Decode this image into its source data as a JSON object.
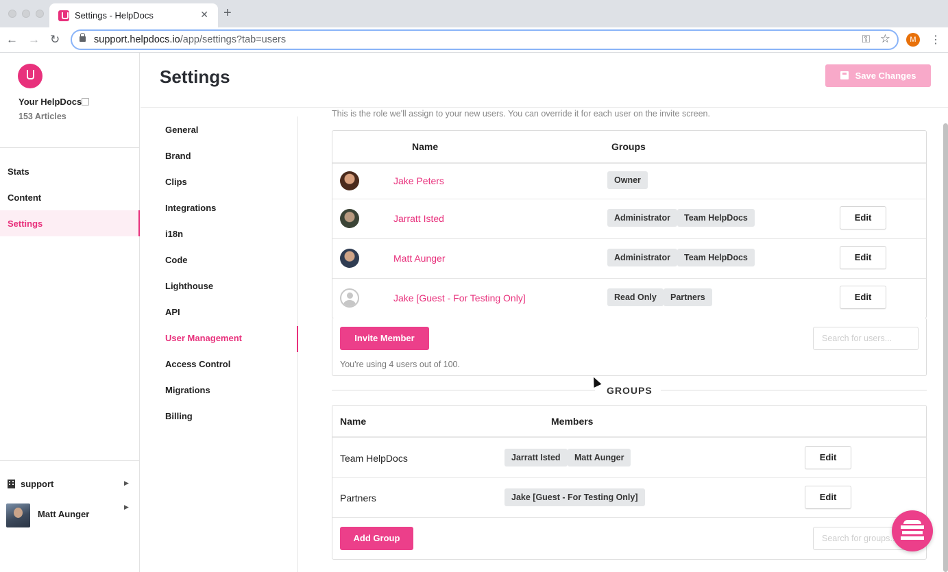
{
  "browser": {
    "tab_title": "Settings - HelpDocs",
    "url_host": "support.helpdocs.io",
    "url_path": "/app/settings?tab=users",
    "profile_initial": "M"
  },
  "sidebar": {
    "site_name": "Your HelpDocs",
    "article_count": "153 Articles",
    "nav": [
      {
        "label": "Stats",
        "active": false
      },
      {
        "label": "Content",
        "active": false
      },
      {
        "label": "Settings",
        "active": true
      }
    ],
    "org": "support",
    "user": "Matt Aunger"
  },
  "header": {
    "title": "Settings",
    "save_label": "Save Changes"
  },
  "settings_nav": [
    {
      "label": "General"
    },
    {
      "label": "Brand"
    },
    {
      "label": "Clips"
    },
    {
      "label": "Integrations"
    },
    {
      "label": "i18n"
    },
    {
      "label": "Code"
    },
    {
      "label": "Lighthouse"
    },
    {
      "label": "API"
    },
    {
      "label": "User Management",
      "active": true
    },
    {
      "label": "Access Control"
    },
    {
      "label": "Migrations"
    },
    {
      "label": "Billing"
    }
  ],
  "users": {
    "hint": "This is the role we'll assign to your new users. You can override it for each user on the invite screen.",
    "columns": [
      "Name",
      "Groups"
    ],
    "rows": [
      {
        "name": "Jake Peters",
        "groups": [
          "Owner"
        ],
        "editable": false
      },
      {
        "name": "Jarratt Isted",
        "groups": [
          "Administrator",
          "Team HelpDocs"
        ],
        "editable": true
      },
      {
        "name": "Matt Aunger",
        "groups": [
          "Administrator",
          "Team HelpDocs"
        ],
        "editable": true
      },
      {
        "name": "Jake [Guest - For Testing Only]",
        "groups": [
          "Read Only",
          "Partners"
        ],
        "editable": true
      }
    ],
    "edit_label": "Edit",
    "invite_label": "Invite Member",
    "search_placeholder": "Search for users...",
    "usage": "You're using 4 users out of 100."
  },
  "groups": {
    "title": "GROUPS",
    "columns": [
      "Name",
      "Members"
    ],
    "rows": [
      {
        "name": "Team HelpDocs",
        "members": [
          "Jarratt Isted",
          "Matt Aunger"
        ]
      },
      {
        "name": "Partners",
        "members": [
          "Jake [Guest - For Testing Only]"
        ]
      }
    ],
    "edit_label": "Edit",
    "add_label": "Add Group",
    "search_placeholder": "Search for groups..."
  },
  "colors": {
    "accent": "#e8317c",
    "button": "#ec3f8a",
    "disabled": "#f8a9c9"
  }
}
